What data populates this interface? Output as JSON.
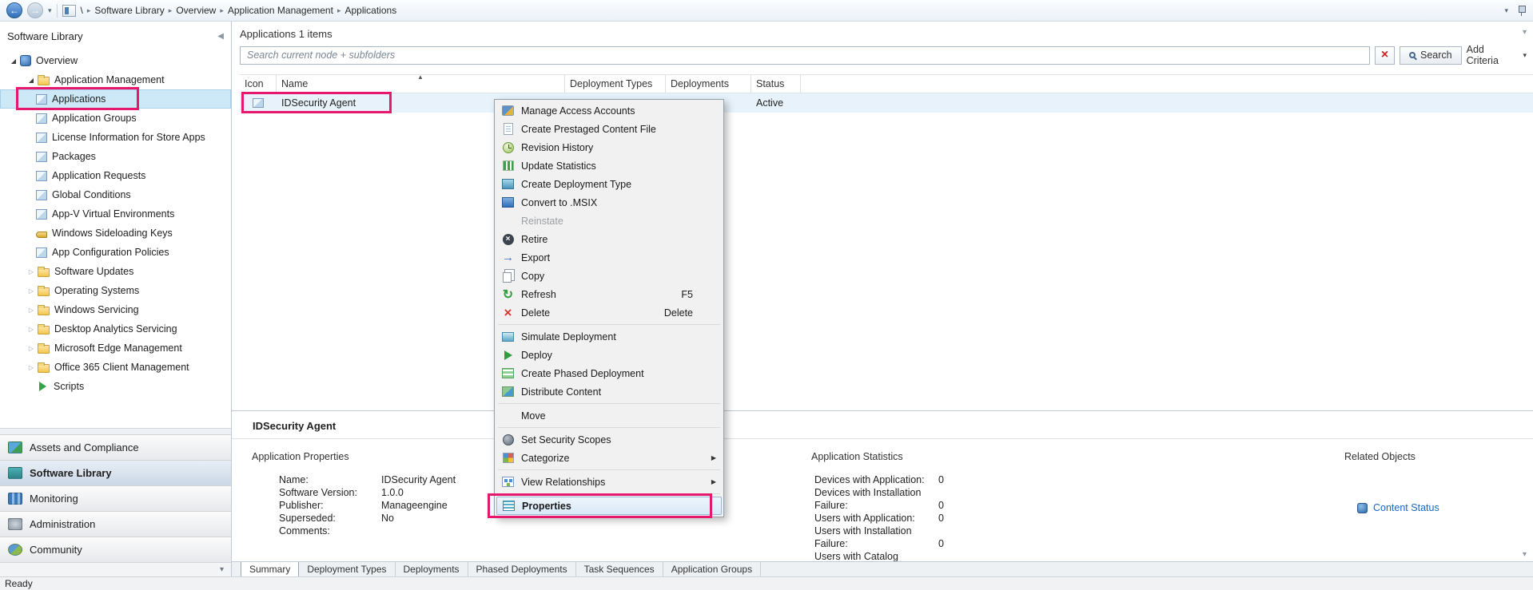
{
  "annotation_color": "#e6186e",
  "topbar": {
    "root": "\\",
    "crumbs": [
      "Software Library",
      "Overview",
      "Application Management",
      "Applications"
    ]
  },
  "sidebar": {
    "title": "Software Library",
    "tree": [
      {
        "label": "Overview"
      },
      {
        "label": "Application Management"
      },
      {
        "label": "Applications"
      },
      {
        "label": "Application Groups"
      },
      {
        "label": "License Information for Store Apps"
      },
      {
        "label": "Packages"
      },
      {
        "label": "Application Requests"
      },
      {
        "label": "Global Conditions"
      },
      {
        "label": "App-V Virtual Environments"
      },
      {
        "label": "Windows Sideloading Keys"
      },
      {
        "label": "App Configuration Policies"
      },
      {
        "label": "Software Updates"
      },
      {
        "label": "Operating Systems"
      },
      {
        "label": "Windows Servicing"
      },
      {
        "label": "Desktop Analytics Servicing"
      },
      {
        "label": "Microsoft Edge Management"
      },
      {
        "label": "Office 365 Client Management"
      },
      {
        "label": "Scripts"
      }
    ],
    "nav": [
      {
        "label": "Assets and Compliance"
      },
      {
        "label": "Software Library"
      },
      {
        "label": "Monitoring"
      },
      {
        "label": "Administration"
      },
      {
        "label": "Community"
      }
    ]
  },
  "main": {
    "title": "Applications 1 items",
    "search": {
      "placeholder": "Search current node + subfolders",
      "button": "Search",
      "add_criteria": "Add Criteria"
    },
    "table": {
      "columns": [
        "Icon",
        "Name",
        "Deployment Types",
        "Deployments",
        "Status"
      ],
      "row": {
        "name": "IDSecurity Agent",
        "status": "Active"
      }
    }
  },
  "menu": {
    "items": [
      {
        "label": "Manage Access Accounts"
      },
      {
        "label": "Create Prestaged Content File"
      },
      {
        "label": "Revision History"
      },
      {
        "label": "Update Statistics"
      },
      {
        "label": "Create Deployment Type"
      },
      {
        "label": "Convert to .MSIX"
      },
      {
        "label": "Reinstate"
      },
      {
        "label": "Retire"
      },
      {
        "label": "Export"
      },
      {
        "label": "Copy"
      },
      {
        "label": "Refresh",
        "shortcut": "F5"
      },
      {
        "label": "Delete",
        "shortcut": "Delete"
      },
      {
        "label": "Simulate Deployment"
      },
      {
        "label": "Deploy"
      },
      {
        "label": "Create Phased Deployment"
      },
      {
        "label": "Distribute Content"
      },
      {
        "label": "Move"
      },
      {
        "label": "Set Security Scopes"
      },
      {
        "label": "Categorize"
      },
      {
        "label": "View Relationships"
      },
      {
        "label": "Properties"
      }
    ]
  },
  "detail": {
    "title": "IDSecurity Agent",
    "properties": {
      "heading": "Application Properties",
      "fields": [
        {
          "label": "Name:",
          "value": "IDSecurity Agent"
        },
        {
          "label": "Software Version:",
          "value": "1.0.0"
        },
        {
          "label": "Publisher:",
          "value": "Manageengine"
        },
        {
          "label": "Superseded:",
          "value": "No"
        },
        {
          "label": "Comments:",
          "value": ""
        }
      ]
    },
    "statistics": {
      "heading": "Application Statistics",
      "fields": [
        {
          "label": "Devices with Application:",
          "value": "0"
        },
        {
          "label": "Devices with Installation Failure:",
          "value": "0"
        },
        {
          "label": "Users with Application:",
          "value": "0"
        },
        {
          "label": "Users with Installation Failure:",
          "value": "0"
        },
        {
          "label": "Users with Catalog",
          "value": ""
        }
      ]
    },
    "related": {
      "heading": "Related Objects",
      "link": "Content Status"
    },
    "tabs": [
      "Summary",
      "Deployment Types",
      "Deployments",
      "Phased Deployments",
      "Task Sequences",
      "Application Groups"
    ]
  },
  "statusbar": {
    "text": "Ready"
  }
}
